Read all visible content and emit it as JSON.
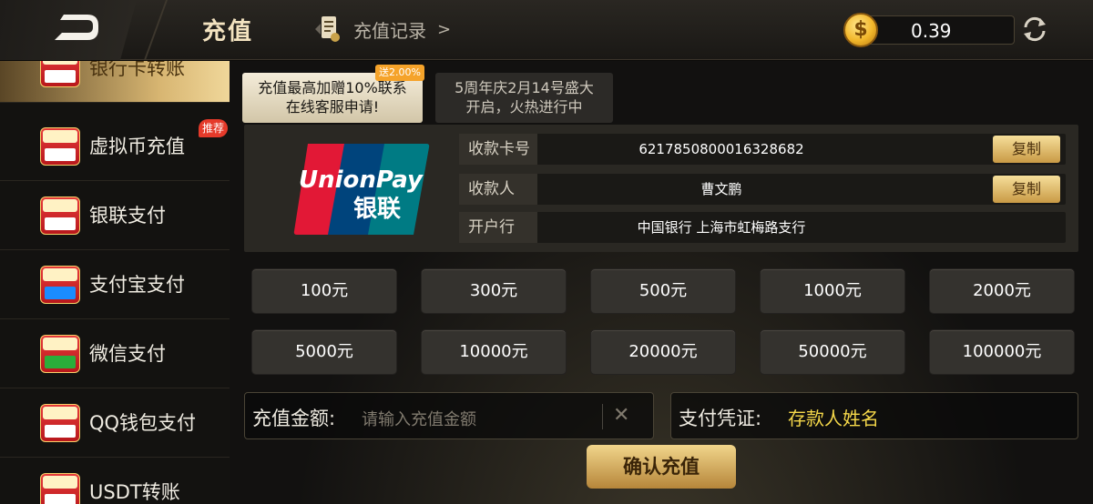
{
  "header": {
    "title": "充值",
    "record_label": "充值记录",
    "record_chevron": ">",
    "balance": "0.39",
    "coin_symbol": "$"
  },
  "sidebar": {
    "items": [
      {
        "label": "银行卡转账",
        "active": true
      },
      {
        "label": "虚拟币充值",
        "active": false
      },
      {
        "label": "银联支付",
        "active": false
      },
      {
        "label": "支付宝支付",
        "active": false
      },
      {
        "label": "微信支付",
        "active": false
      },
      {
        "label": "QQ钱包支付",
        "active": false
      },
      {
        "label": "USDT转账",
        "active": false
      }
    ],
    "hot_badge": "推荐"
  },
  "promo": {
    "tab1_line1": "充值最高加赠10%联系",
    "tab1_line2": "在线客服申请!",
    "bonus_tag": "送2.00%",
    "tab2_line1": "5周年庆2月14号盛大",
    "tab2_line2": "开启，火热进行中"
  },
  "card": {
    "logo_text": "UnionPay",
    "logo_cn": "银联",
    "rows": [
      {
        "label": "收款卡号",
        "value": "6217850800016328682",
        "copy": "复制"
      },
      {
        "label": "收款人",
        "value": "曹文鹏",
        "copy": "复制"
      },
      {
        "label": "开户行",
        "value": "中国银行 上海市虹梅路支行"
      }
    ]
  },
  "amounts": [
    "100元",
    "300元",
    "500元",
    "1000元",
    "2000元",
    "5000元",
    "10000元",
    "20000元",
    "50000元",
    "100000元"
  ],
  "inputs": {
    "amount_label": "充值金额:",
    "amount_placeholder": "请输入充值金额",
    "clear_symbol": "✕",
    "voucher_label": "支付凭证:",
    "voucher_value": "存款人姓名"
  },
  "confirm_label": "确认充值",
  "colors": {
    "accent_gold": "#d8b672",
    "voucher_text": "#f5d84a",
    "badge_red": "#e53a2a",
    "bonus_orange": "#f5a32a"
  }
}
